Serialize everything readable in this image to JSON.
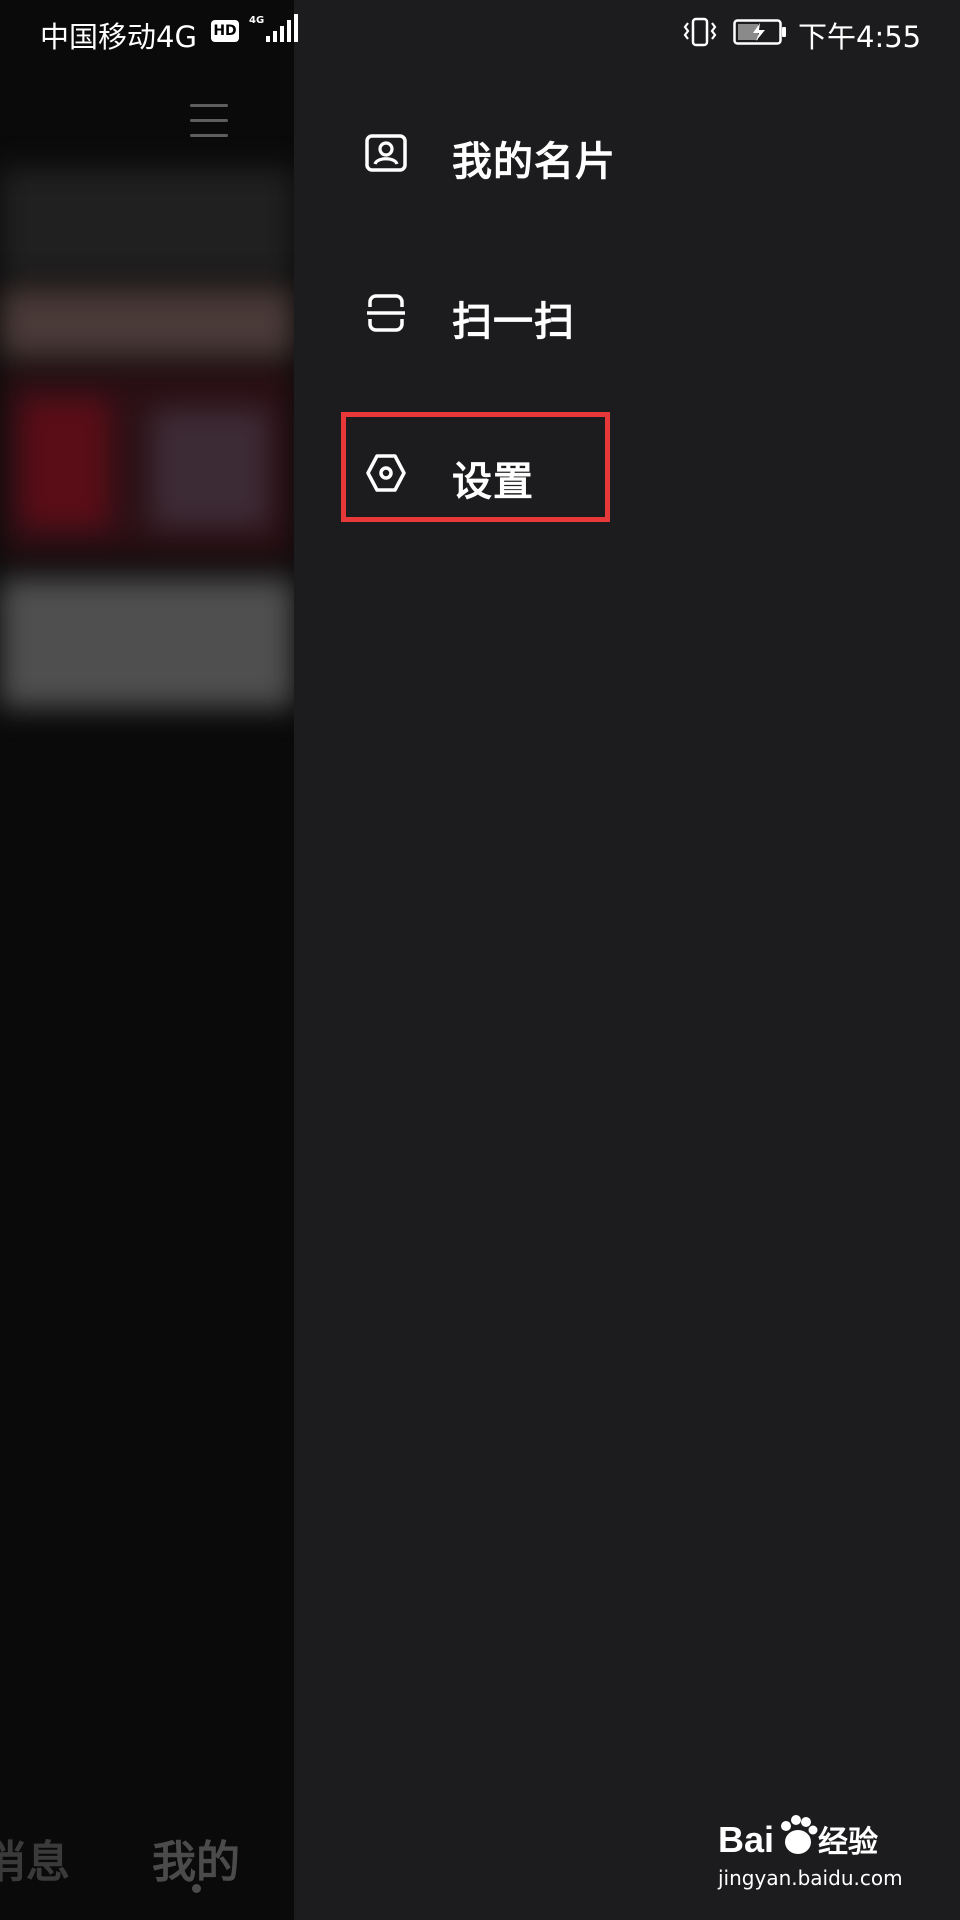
{
  "status_bar": {
    "carrier": "中国移动4G",
    "hd_badge": "HD",
    "network_type": "4G",
    "time": "下午4:55",
    "icons": [
      "hd-icon",
      "signal-icon",
      "vibrate-icon",
      "battery-charging-icon"
    ]
  },
  "drawer": {
    "items": [
      {
        "label": "我的名片",
        "icon": "contact-card-icon"
      },
      {
        "label": "扫一扫",
        "icon": "scan-icon"
      },
      {
        "label": "设置",
        "icon": "settings-icon"
      }
    ],
    "highlighted_item": "设置",
    "highlight_color": "#e8383a"
  },
  "background_app": {
    "icons": [
      "menu-icon"
    ],
    "tabs": [
      {
        "label": "消息"
      },
      {
        "label": "我的"
      }
    ]
  },
  "watermark": {
    "brand": "Bai 经验",
    "url": "jingyan.baidu.com"
  }
}
